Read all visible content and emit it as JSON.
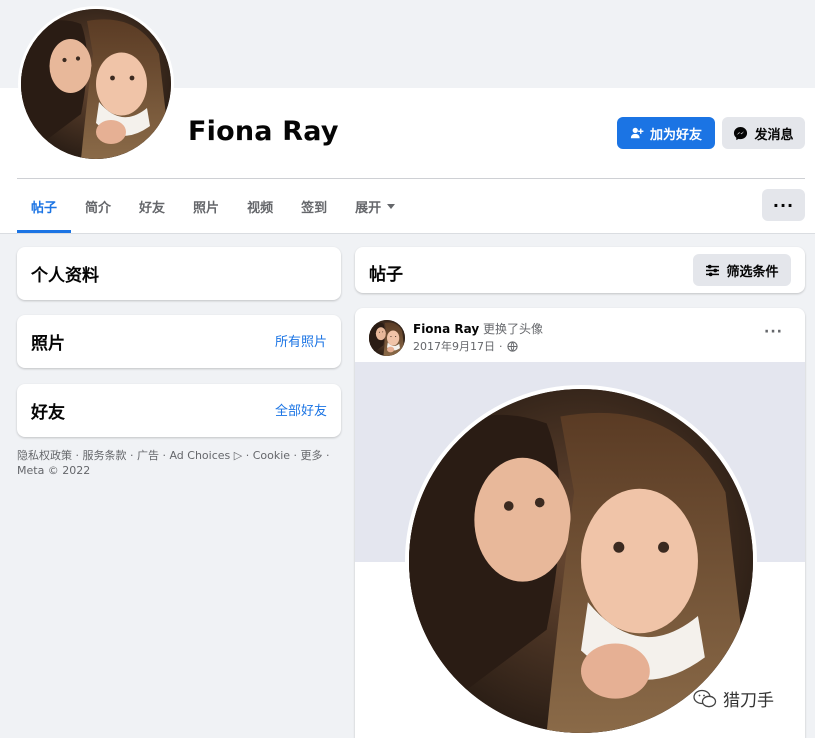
{
  "profile": {
    "name": "Fiona Ray",
    "add_friend_label": "加为好友",
    "message_label": "发消息"
  },
  "tabs": [
    {
      "label": "帖子",
      "active": true
    },
    {
      "label": "简介",
      "active": false
    },
    {
      "label": "好友",
      "active": false
    },
    {
      "label": "照片",
      "active": false
    },
    {
      "label": "视频",
      "active": false
    },
    {
      "label": "签到",
      "active": false
    },
    {
      "label": "展开",
      "active": false
    }
  ],
  "more_button_label": "···",
  "left": {
    "intro_title": "个人资料",
    "photos_title": "照片",
    "photos_link": "所有照片",
    "friends_title": "好友",
    "friends_link": "全部好友",
    "footer": "隐私权政策 · 服务条款 · 广告 · Ad Choices ▷ · Cookie · 更多 · Meta © 2022"
  },
  "posts_panel": {
    "title": "帖子",
    "filter_label": "筛选条件"
  },
  "post": {
    "author": "Fiona Ray",
    "action": "更换了头像",
    "date": "2017年9月17日",
    "menu": "···"
  },
  "watermark": "猎刀手",
  "icons": {
    "add_friend": "person-plus-icon",
    "message": "messenger-icon",
    "filter": "sliders-icon",
    "privacy": "globe-icon",
    "watermark": "wechat-icon"
  },
  "colors": {
    "accent": "#1b74e4",
    "page_bg": "#f0f2f5",
    "card_bg": "#ffffff",
    "secondary_button": "#e4e6eb"
  }
}
